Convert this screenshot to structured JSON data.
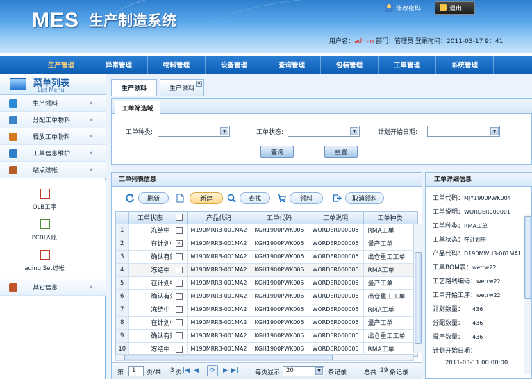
{
  "header": {
    "logo": "MES",
    "system_name": "生产制造系统",
    "change_password": "修改密码",
    "logout": "退出",
    "user_label": "用户名：",
    "username": "admin",
    "dept_label": "部门：",
    "dept": "管理员",
    "login_time_label": "登录时间：",
    "login_time": "2011-03-17 9：41"
  },
  "nav": [
    "生产管理",
    "异常管理",
    "物料管理",
    "设备管理",
    "查询管理",
    "包装管理",
    "工单管理",
    "系统管理"
  ],
  "sidebar": {
    "title": "菜单列表",
    "subtitle": "List  Menu",
    "items": [
      {
        "label": "生产领料",
        "chev": "»"
      },
      {
        "label": "分配工单物料",
        "chev": "»"
      },
      {
        "label": "释放工单物料",
        "chev": "»"
      },
      {
        "label": "工单信息维护",
        "chev": "»"
      },
      {
        "label": "站点过帐",
        "chev": "«"
      }
    ],
    "subitems": [
      "OLB工序",
      "PCBI入账",
      "aging Set过帐"
    ],
    "other": {
      "label": "其它信息",
      "chev": "»"
    }
  },
  "tabs": [
    "生产领料",
    "生产领料"
  ],
  "filter": {
    "title": "工单筛选域",
    "type_label": "工单种类:",
    "status_label": "工单状态:",
    "date_label": "计划开始日期:",
    "query": "查询",
    "reset": "重置"
  },
  "list": {
    "title": "工单列表信息",
    "toolbar": [
      "刷新",
      "新建",
      "查找",
      "领料",
      "取消领料"
    ],
    "columns": [
      "工单状态",
      "产品代码",
      "工单代码",
      "工单说明",
      "工单种类"
    ],
    "rows": [
      {
        "n": "1",
        "status": "冻结中",
        "product": "M190MRR3-001MA2",
        "code": "KGH1900PWK005",
        "desc": "WORDER000005",
        "type": "RMA工单",
        "checked": false
      },
      {
        "n": "2",
        "status": "在计划中",
        "product": "M190MRR3-001MA2",
        "code": "KGH1900PWK005",
        "desc": "WORDER000005",
        "type": "量产工单",
        "checked": true
      },
      {
        "n": "3",
        "status": "确认有效",
        "product": "M190MRR3-001MA2",
        "code": "KGH1900PWK005",
        "desc": "WORDER000005",
        "type": "出仓重工工单",
        "checked": false
      },
      {
        "n": "4",
        "status": "冻结中",
        "product": "M190MRR3-001MA2",
        "code": "KGH1900PWK005",
        "desc": "WORDER000005",
        "type": "RMA工单",
        "checked": false
      },
      {
        "n": "5",
        "status": "在计划中",
        "product": "M190MRR3-001MA2",
        "code": "KGH1900PWK005",
        "desc": "WORDER000005",
        "type": "量产工单",
        "checked": false
      },
      {
        "n": "6",
        "status": "确认有效",
        "product": "M190MRR3-001MA2",
        "code": "KGH1900PWK005",
        "desc": "WORDER000005",
        "type": "出仓重工工单",
        "checked": false
      },
      {
        "n": "7",
        "status": "冻结中",
        "product": "M190MRR3-001MA2",
        "code": "KGH1900PWK005",
        "desc": "WORDER000005",
        "type": "RMA工单",
        "checked": false
      },
      {
        "n": "8",
        "status": "在计划中",
        "product": "M190MRR3-001MA2",
        "code": "KGH1900PWK005",
        "desc": "WORDER000005",
        "type": "量产工单",
        "checked": false
      },
      {
        "n": "9",
        "status": "确认有效",
        "product": "M190MRR3-001MA2",
        "code": "KGH1900PWK005",
        "desc": "WORDER000005",
        "type": "出仓重工工单",
        "checked": false
      },
      {
        "n": "10",
        "status": "冻结中",
        "product": "M190MRR3-001MA2",
        "code": "KGH1900PWK005",
        "desc": "WORDER000005",
        "type": "RMA工单",
        "checked": false
      }
    ],
    "pager": {
      "page_prefix": "第",
      "page": "1",
      "page_suffix": "页/共",
      "total_pages": "3",
      "pages_word": "页",
      "per_page_label": "每页显示",
      "per_page": "20",
      "records_word": "条记录",
      "total_label": "总共",
      "total": "29",
      "total_suffix": "条记录"
    }
  },
  "detail": {
    "title": "工单详细信息",
    "fields": [
      {
        "label": "工单代码：",
        "value": "MJY1900PWK004"
      },
      {
        "label": "工单说明：",
        "value": "WORDER000001"
      },
      {
        "label": "工单种类：",
        "value": "RMA工单"
      },
      {
        "label": "工单状态：",
        "value": "在计划中"
      },
      {
        "label": "产品代码：",
        "value": "D190MWH3-001MA1"
      },
      {
        "label": "工单BOM表：",
        "value": "wetrw22"
      },
      {
        "label": "工艺路线编码：",
        "value": "wetrw22"
      },
      {
        "label": "工单开始工序：",
        "value": "wetrw22"
      },
      {
        "label": "计划数量：",
        "value": "436"
      },
      {
        "label": "分配数量：",
        "value": "436"
      },
      {
        "label": "投产数量：",
        "value": "436"
      },
      {
        "label": "计划开始日期：",
        "value": ""
      }
    ],
    "start_date": "2011-03-11 00:00:00"
  }
}
